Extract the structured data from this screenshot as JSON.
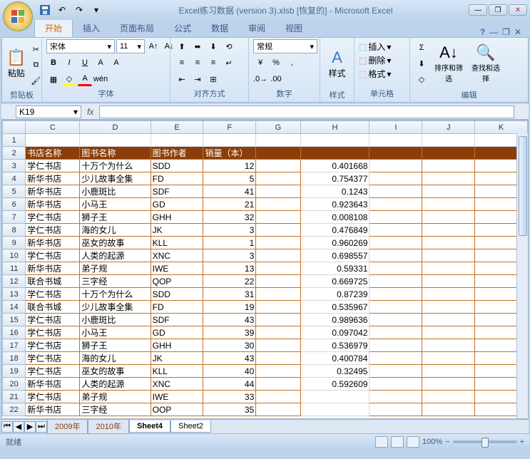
{
  "title": "Excel练习数据 (version 3).xlsb [恢复的] - Microsoft Excel",
  "tabs": [
    "开始",
    "插入",
    "页面布局",
    "公式",
    "数据",
    "审阅",
    "视图"
  ],
  "activeTab": 0,
  "font": {
    "name": "宋体",
    "size": "11"
  },
  "numberFormat": "常规",
  "groups": {
    "clipboard": "剪贴板",
    "paste": "粘贴",
    "font": "字体",
    "align": "对齐方式",
    "number": "数字",
    "styles": "样式",
    "stylesBtn": "样式",
    "cells": "单元格",
    "editing": "编辑"
  },
  "cellOps": {
    "insert": "插入",
    "delete": "删除",
    "format": "格式"
  },
  "editOps": {
    "sort": "排序和筛选",
    "find": "查找和选择"
  },
  "namebox": "K19",
  "columns": [
    "",
    "C",
    "D",
    "E",
    "F",
    "G",
    "H",
    "I",
    "J",
    "K"
  ],
  "headers": {
    "c": "书店名称",
    "d": "图书名称",
    "e": "图书作者",
    "f": "销量（本）"
  },
  "rows": [
    {
      "n": 1
    },
    {
      "n": 2,
      "header": true
    },
    {
      "n": 3,
      "c": "学仁书店",
      "d": "十万个为什么",
      "e": "SDD",
      "f": 12,
      "h": 0.401668
    },
    {
      "n": 4,
      "c": "新华书店",
      "d": "少儿故事全集",
      "e": "FD",
      "f": 5,
      "h": 0.754377
    },
    {
      "n": 5,
      "c": "新华书店",
      "d": "小鹿斑比",
      "e": "SDF",
      "f": 41,
      "h": 0.1243
    },
    {
      "n": 6,
      "c": "新华书店",
      "d": "小马王",
      "e": "GD",
      "f": 21,
      "h": 0.923643
    },
    {
      "n": 7,
      "c": "学仁书店",
      "d": "狮子王",
      "e": "GHH",
      "f": 32,
      "h": 0.008108
    },
    {
      "n": 8,
      "c": "学仁书店",
      "d": "海的女儿",
      "e": "JK",
      "f": 3,
      "h": 0.476849
    },
    {
      "n": 9,
      "c": "新华书店",
      "d": "巫女的故事",
      "e": "KLL",
      "f": 1,
      "h": 0.960269
    },
    {
      "n": 10,
      "c": "学仁书店",
      "d": "人类的起源",
      "e": "XNC",
      "f": 3,
      "h": 0.698557
    },
    {
      "n": 11,
      "c": "新华书店",
      "d": "弟子规",
      "e": "IWE",
      "f": 13,
      "h": 0.59331
    },
    {
      "n": 12,
      "c": "联合书城",
      "d": "三字经",
      "e": "QOP",
      "f": 22,
      "h": 0.669725
    },
    {
      "n": 13,
      "c": "学仁书店",
      "d": "十万个为什么",
      "e": "SDD",
      "f": 31,
      "h": 0.87239
    },
    {
      "n": 14,
      "c": "联合书城",
      "d": "少儿故事全集",
      "e": "FD",
      "f": 19,
      "h": 0.535967
    },
    {
      "n": 15,
      "c": "学仁书店",
      "d": "小鹿斑比",
      "e": "SDF",
      "f": 43,
      "h": 0.989636
    },
    {
      "n": 16,
      "c": "学仁书店",
      "d": "小马王",
      "e": "GD",
      "f": 39,
      "h": 0.097042
    },
    {
      "n": 17,
      "c": "学仁书店",
      "d": "狮子王",
      "e": "GHH",
      "f": 30,
      "h": 0.536979
    },
    {
      "n": 18,
      "c": "学仁书店",
      "d": "海的女儿",
      "e": "JK",
      "f": 43,
      "h": 0.400784
    },
    {
      "n": 19,
      "c": "学仁书店",
      "d": "巫女的故事",
      "e": "KLL",
      "f": 40,
      "h": 0.32495
    },
    {
      "n": 20,
      "c": "新华书店",
      "d": "人类的起源",
      "e": "XNC",
      "f": 44,
      "h": 0.592609
    },
    {
      "n": 21,
      "c": "学仁书店",
      "d": "弟子规",
      "e": "IWE",
      "f": 33
    },
    {
      "n": 22,
      "c": "新华书店",
      "d": "三字经",
      "e": "OOP",
      "f": 35
    }
  ],
  "sheets": [
    "2009年",
    "2010年",
    "Sheet4",
    "Sheet2"
  ],
  "activeSheet": 2,
  "status": "就绪",
  "zoom": "100%"
}
